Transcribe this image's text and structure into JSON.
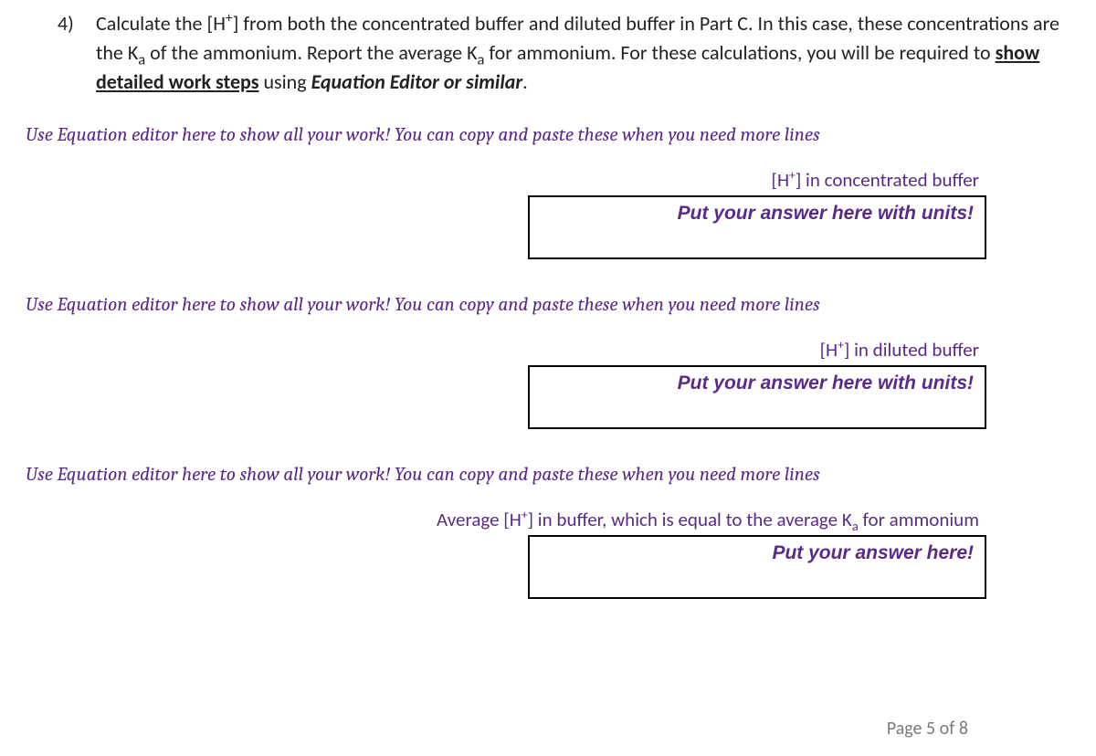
{
  "question": {
    "number": "4)",
    "text_pre": "Calculate the [H",
    "sup1": "+",
    "text_mid1": "] from both the concentrated buffer and diluted buffer in Part C. In this case, these concentrations are the K",
    "sub1": "a",
    "text_mid2": " of the ammonium. Report the average K",
    "sub2": "a",
    "text_mid3": " for ammonium. For these calculations, you will be required to ",
    "underline": "show detailed work steps",
    "text_mid4": " using ",
    "bolditalic": "Equation Editor or similar",
    "text_end": "."
  },
  "instruction": "Use Equation editor here to show all your work! You can copy and paste these when you need more lines",
  "blocks": [
    {
      "label_pre": "[H",
      "label_sup": "+",
      "label_post": "] in concentrated buffer",
      "placeholder": "Put your answer here with units!"
    },
    {
      "label_pre": "[H",
      "label_sup": "+",
      "label_post": "] in diluted buffer",
      "placeholder": "Put your answer here with units!"
    },
    {
      "label_pre": "Average [H",
      "label_sup": "+",
      "label_post": "] in buffer, which is equal to the average K",
      "label_sub": "a",
      "label_post2": " for ammonium",
      "placeholder": "Put your answer here!"
    }
  ],
  "footer": {
    "prefix": "Page ",
    "current": "5",
    "of": " of ",
    "total": "8"
  }
}
